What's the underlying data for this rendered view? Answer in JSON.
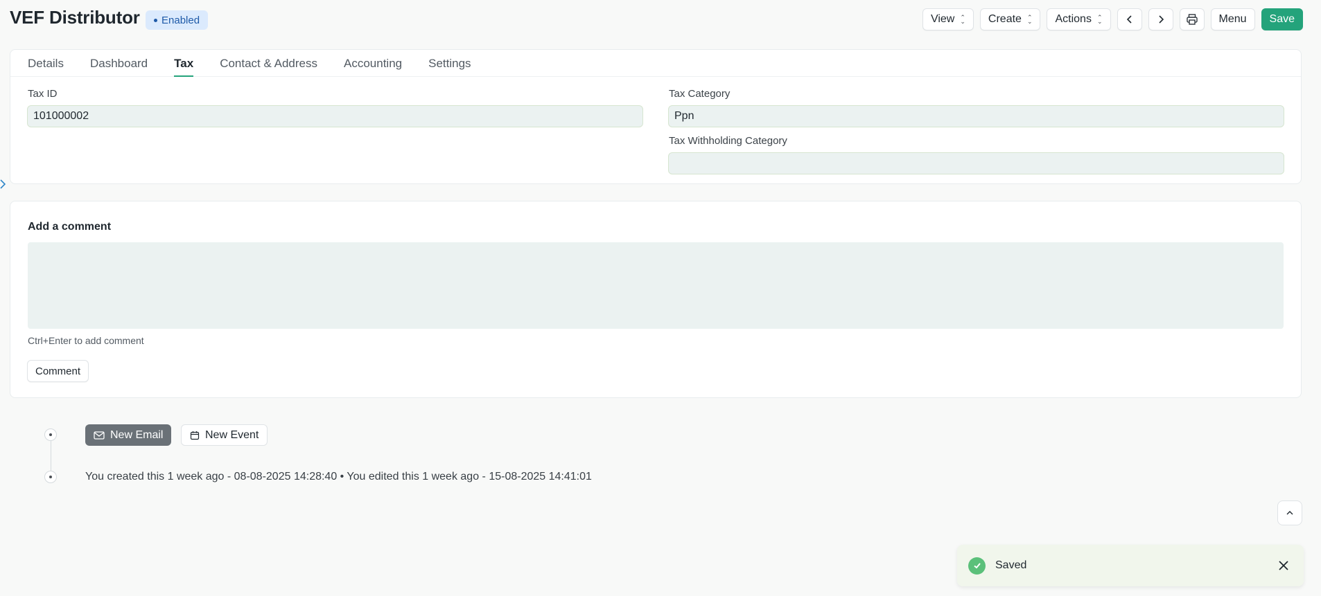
{
  "header": {
    "title": "VEF Distributor",
    "status": "Enabled"
  },
  "toolbar": {
    "view": "View",
    "create": "Create",
    "actions": "Actions",
    "menu": "Menu",
    "save": "Save"
  },
  "tabs": [
    {
      "label": "Details"
    },
    {
      "label": "Dashboard"
    },
    {
      "label": "Tax",
      "active": true
    },
    {
      "label": "Contact & Address"
    },
    {
      "label": "Accounting"
    },
    {
      "label": "Settings"
    }
  ],
  "tax": {
    "tax_id_label": "Tax ID",
    "tax_id_value": "101000002",
    "tax_category_label": "Tax Category",
    "tax_category_value": "Ppn",
    "tax_withholding_label": "Tax Withholding Category",
    "tax_withholding_value": ""
  },
  "comment": {
    "title": "Add a comment",
    "hint": "Ctrl+Enter to add comment",
    "button": "Comment"
  },
  "timeline": {
    "new_email": "New Email",
    "new_event": "New Event",
    "activity": "You created this 1 week ago - 08-08-2025 14:28:40 • You edited this 1 week ago - 15-08-2025 14:41:01"
  },
  "toast": {
    "message": "Saved"
  },
  "colors": {
    "primary": "#24a37b",
    "badge_bg": "#dbeafd",
    "badge_text": "#1e5aa8",
    "success": "#5bc07a"
  }
}
